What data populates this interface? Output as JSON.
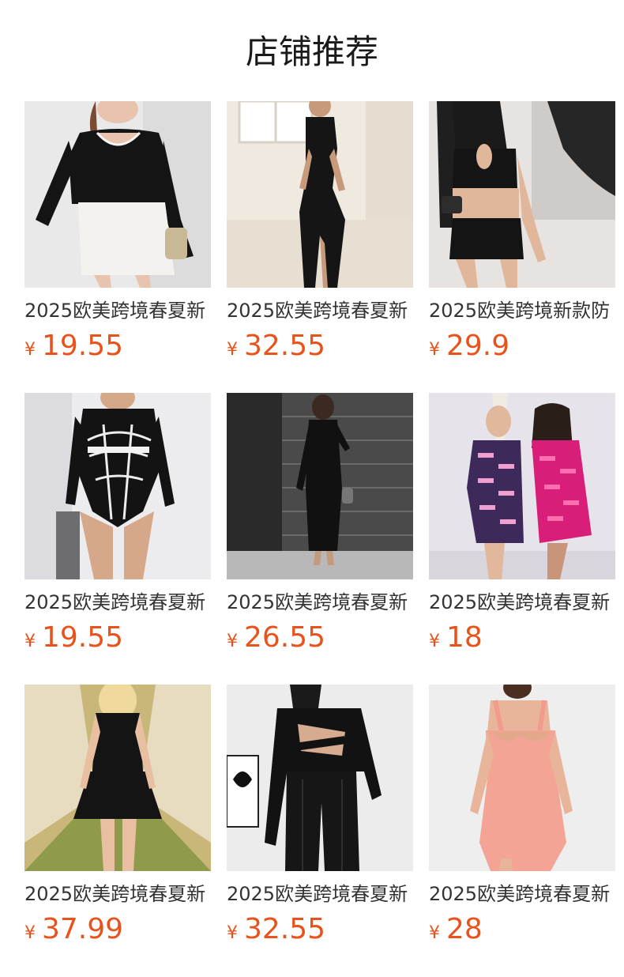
{
  "section": {
    "title": "店铺推荐"
  },
  "currency_symbol": "¥",
  "colors": {
    "price": "#e8531c",
    "title": "#1a1a1a",
    "text": "#333333"
  },
  "products": [
    {
      "title": "2025欧美跨境春夏新",
      "price": "19.55",
      "image": "woman-black-long-sleeve-top-white-skirt"
    },
    {
      "title": "2025欧美跨境春夏新",
      "price": "32.55",
      "image": "woman-black-halter-slit-maxi-dress"
    },
    {
      "title": "2025欧美跨境新款防",
      "price": "29.9",
      "image": "woman-black-cutout-crop-top-mini-skirt"
    },
    {
      "title": "2025欧美跨境春夏新",
      "price": "19.55",
      "image": "woman-black-white-web-print-bodysuit"
    },
    {
      "title": "2025欧美跨境春夏新",
      "price": "26.55",
      "image": "woman-black-long-sleeve-maxi-dress"
    },
    {
      "title": "2025欧美跨境春夏新",
      "price": "18",
      "image": "two-women-printed-mesh-bodysuits"
    },
    {
      "title": "2025欧美跨境春夏新",
      "price": "37.99",
      "image": "woman-black-corset-mini-dress-hallway"
    },
    {
      "title": "2025欧美跨境春夏新",
      "price": "32.55",
      "image": "woman-black-cutout-top-cargo-pants"
    },
    {
      "title": "2025欧美跨境春夏新",
      "price": "28",
      "image": "woman-pink-halter-bodycon-dress"
    }
  ]
}
